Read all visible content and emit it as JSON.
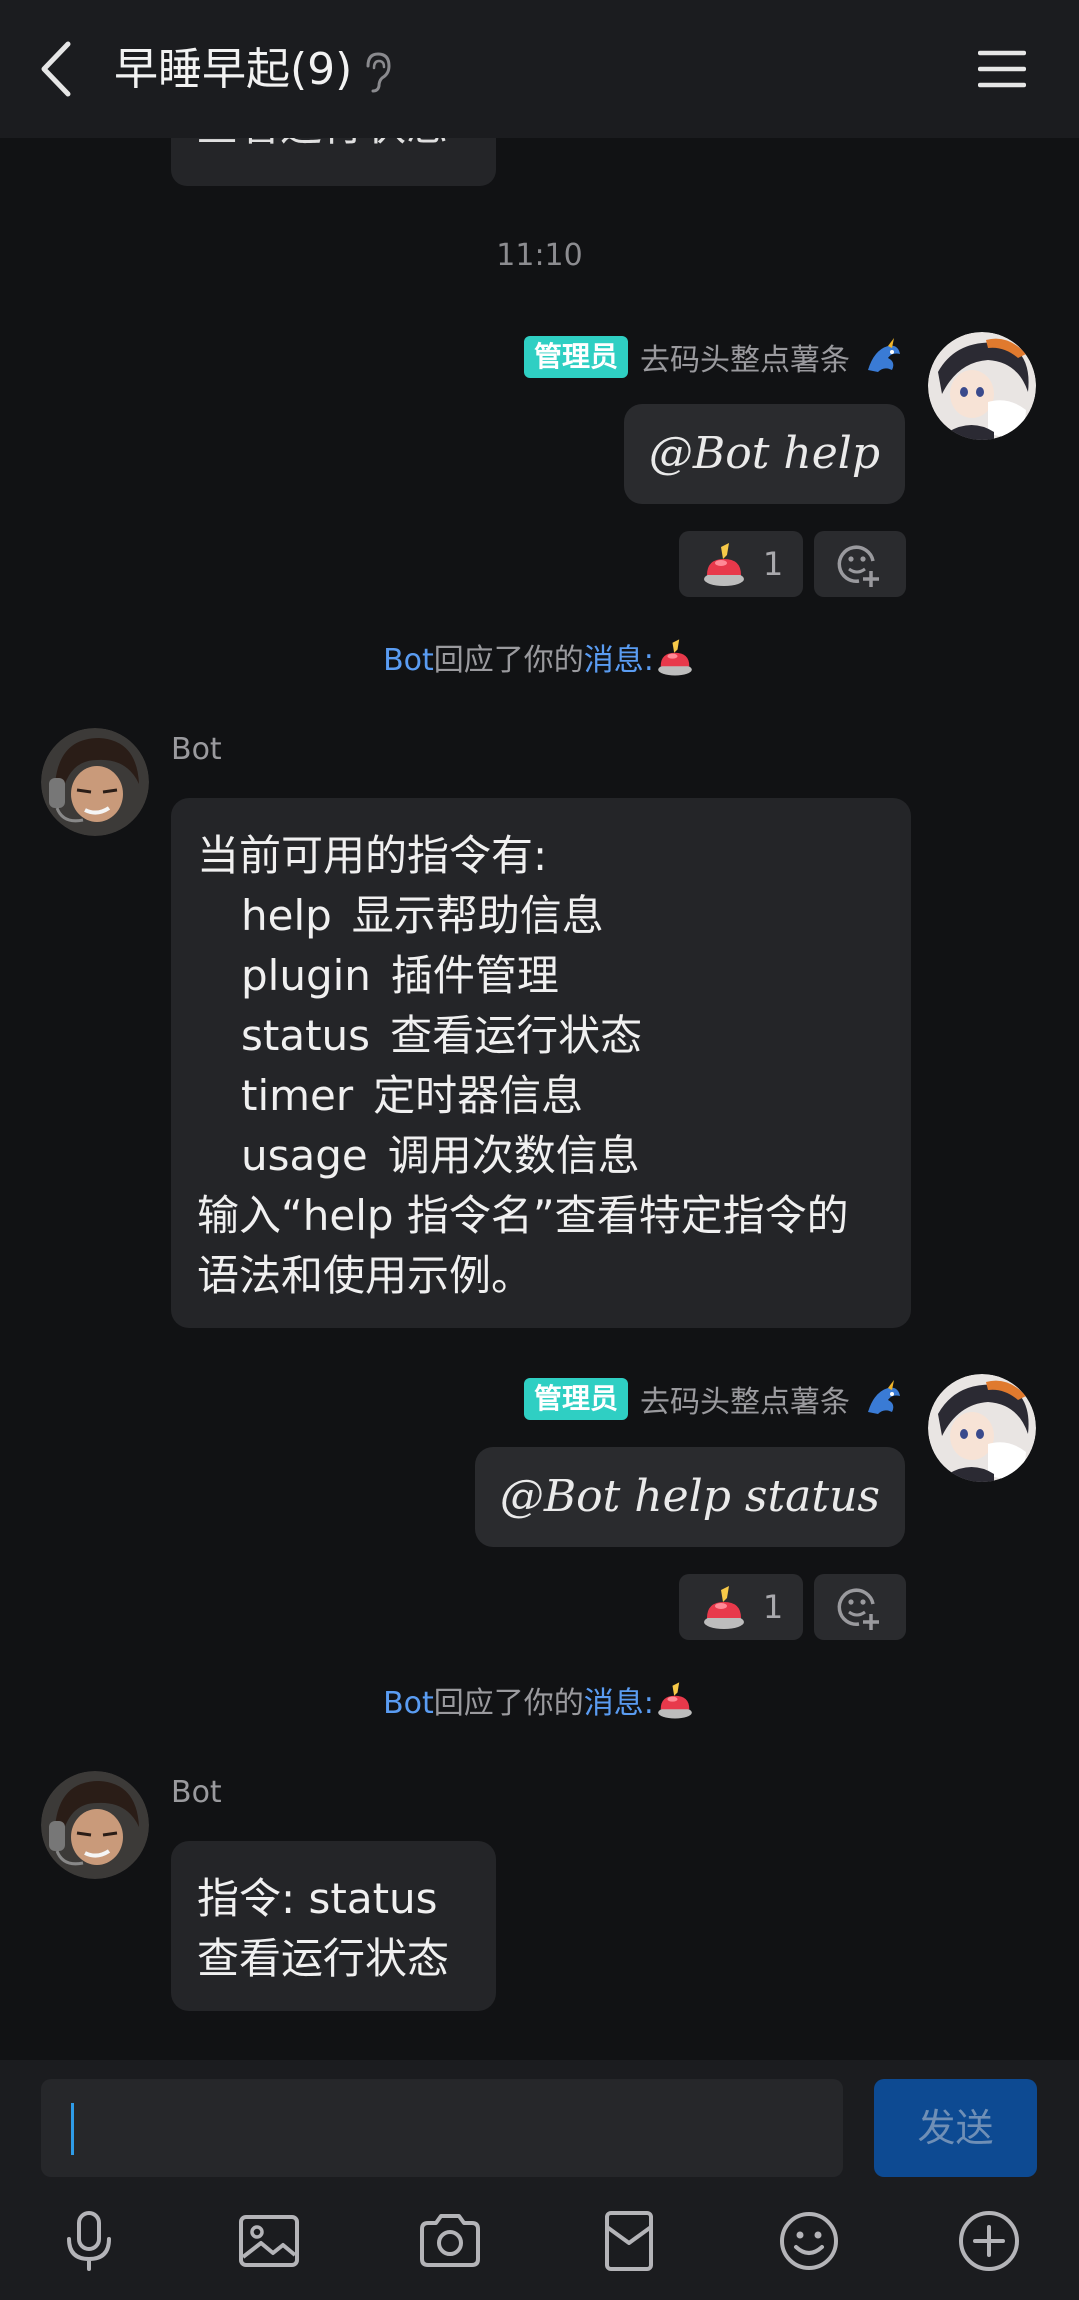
{
  "header": {
    "title": "早睡早起(9)"
  },
  "partial_message": {
    "text": "查看运行状态"
  },
  "timestamp": "11:10",
  "messages": [
    {
      "badge": "管理员",
      "sender": "去码头整点薯条",
      "text": "@Bot help",
      "reaction_count": "1"
    },
    {
      "badge": "管理员",
      "sender": "去码头整点薯条",
      "text": "@Bot help status",
      "reaction_count": "1"
    }
  ],
  "notices": [
    {
      "actor": "Bot",
      "middle": "回应了你的",
      "link": "消息:"
    },
    {
      "actor": "Bot",
      "middle": "回应了你的",
      "link": "消息:"
    }
  ],
  "bot": {
    "name": "Bot",
    "help_reply": {
      "intro": "当前可用的指令有:",
      "commands": [
        {
          "cmd": "help",
          "desc": "显示帮助信息"
        },
        {
          "cmd": "plugin",
          "desc": "插件管理"
        },
        {
          "cmd": "status",
          "desc": "查看运行状态"
        },
        {
          "cmd": "timer",
          "desc": "定时器信息"
        },
        {
          "cmd": "usage",
          "desc": "调用次数信息"
        }
      ],
      "footer_line1": "输入“help 指令名”查看特定指令的",
      "footer_line2": "语法和使用示例。"
    },
    "status_reply": {
      "line1": "指令:  status",
      "line2": "查看运行状态"
    }
  },
  "composer": {
    "value": "",
    "send_label": "发送"
  },
  "toolbar": {
    "icons": [
      "microphone-icon",
      "image-icon",
      "camera-icon",
      "red-packet-icon",
      "emoji-icon",
      "plus-icon"
    ]
  },
  "colors": {
    "accent": "#5a9cf2",
    "admin_badge": "#2fcfc3",
    "send_button": "#0d4a92",
    "background": "#111214"
  }
}
